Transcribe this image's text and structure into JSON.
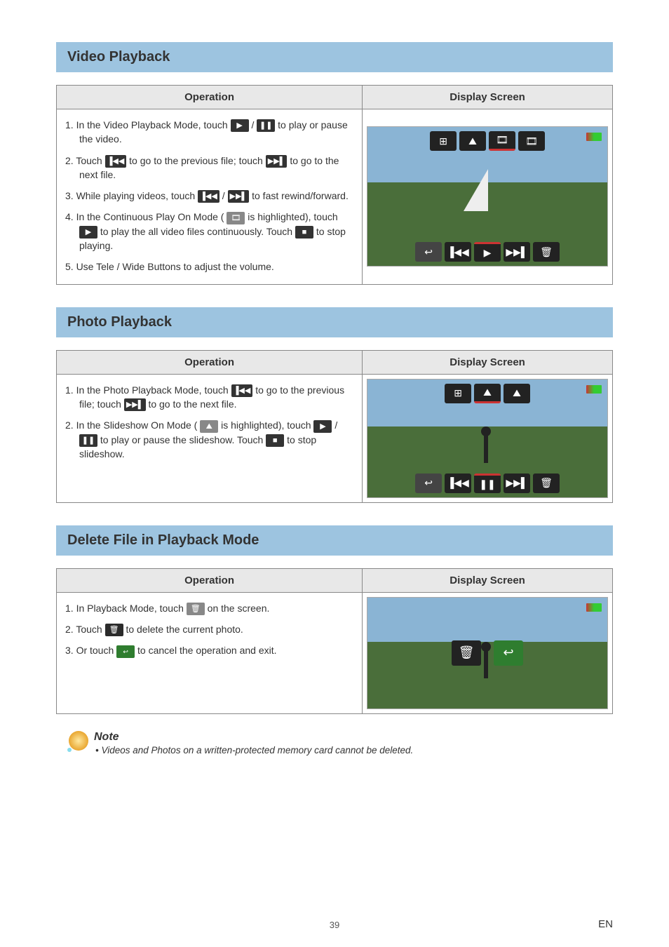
{
  "sections": {
    "video": {
      "title": "Video Playback",
      "header_op": "Operation",
      "header_ds": "Display Screen",
      "steps": {
        "s1a": "1.  In the Video Playback Mode, touch ",
        "s1b": " / ",
        "s1c": "  to play or pause the video.",
        "s2a": "2.  Touch ",
        "s2b": "  to go to the previous file; touch ",
        "s2c": "  to go to the next file.",
        "s3a": "3.  While playing videos, touch ",
        "s3b": "  / ",
        "s3c": "  to fast rewind/forward.",
        "s4a": "4.  In the Continuous Play On Mode ( ",
        "s4b": "  is highlighted), touch ",
        "s4c": "  to play the all video files continuously. Touch ",
        "s4d": "  to stop playing.",
        "s5": "5.  Use Tele / Wide Buttons to adjust the volume."
      }
    },
    "photo": {
      "title": "Photo Playback",
      "header_op": "Operation",
      "header_ds": "Display Screen",
      "steps": {
        "s1a": "1.  In the Photo Playback Mode, touch ",
        "s1b": "  to go to the previous file; touch ",
        "s1c": "  to go to the next file.",
        "s2a": "2.  In the Slideshow On Mode ( ",
        "s2b": "  is highlighted), touch ",
        "s2c": " / ",
        "s2d": "  to play or pause the slideshow. Touch ",
        "s2e": "  to stop slideshow."
      }
    },
    "delete": {
      "title": "Delete File in Playback Mode",
      "header_op": "Operation",
      "header_ds": "Display Screen",
      "steps": {
        "s1a": "1.  In Playback Mode, touch ",
        "s1b": "  on the screen.",
        "s2a": "2.  Touch ",
        "s2b": " to delete the current photo.",
        "s3a": "3.  Or touch ",
        "s3b": " to cancel the operation and exit."
      }
    }
  },
  "note": {
    "title": "Note",
    "bullet": "•  Videos and Photos on a written-protected memory card cannot be deleted."
  },
  "icons": {
    "play": "▶",
    "pause": "❚❚",
    "stop": "■",
    "prev": "▐◀◀",
    "next": "▶▶▌",
    "rew": "▐◀◀",
    "fwd": "▶▶▌",
    "film": "🎞",
    "slide": "⛰",
    "trash": "🗑",
    "back": "↩",
    "grid": "⊞",
    "mount": "⛰",
    "reel": "🎞"
  },
  "footer": {
    "page": "39",
    "lang": "EN"
  }
}
